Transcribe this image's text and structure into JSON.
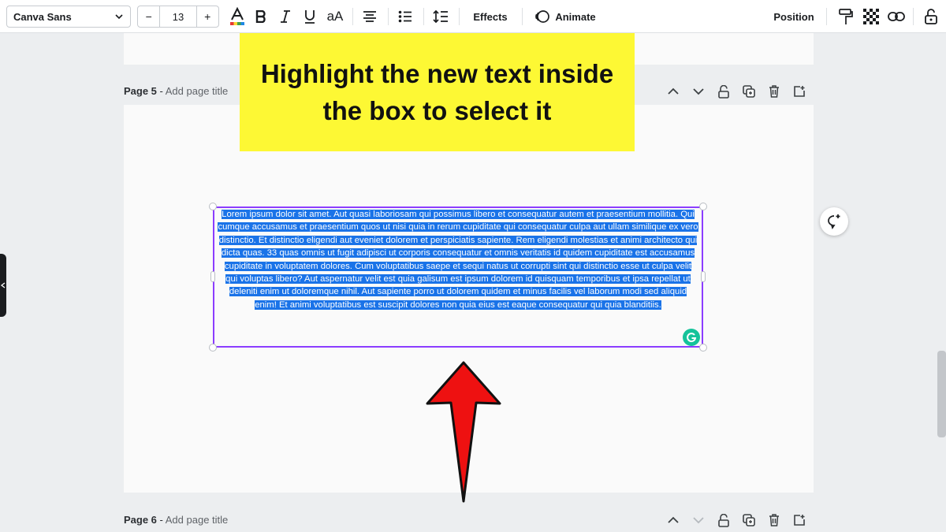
{
  "toolbar": {
    "font_family": "Canva Sans",
    "font_size": "13",
    "decrease_label": "−",
    "increase_label": "+",
    "case_label": "aA",
    "effects_label": "Effects",
    "animate_label": "Animate",
    "position_label": "Position"
  },
  "callout": {
    "line1": "Highlight the new text inside",
    "line2": "the box to select it"
  },
  "page5": {
    "label": "Page 5",
    "sep": " - ",
    "title_placeholder": "Add page title"
  },
  "page6": {
    "label": "Page 6",
    "sep": " - ",
    "title_placeholder": "Add page title"
  },
  "textbox": {
    "content": "Lorem ipsum dolor sit amet. Aut quasi laboriosam qui possimus libero et consequatur autem et praesentium mollitia. Qui cumque accusamus et praesentium quos ut nisi quia in rerum cupiditate qui consequatur culpa aut ullam similique ex vero distinctio. Et distinctio eligendi aut eveniet dolorem et perspiciatis sapiente. Rem eligendi molestias et animi architecto qui dicta quas. 33 quas omnis ut fugit adipisci ut corporis consequatur et omnis veritatis id quidem cupiditate est accusamus cupiditate in voluptatem dolores. Cum voluptatibus saepe et sequi natus ut corrupti sint qui distinctio esse ut culpa velit qui voluptas libero? Aut aspernatur velit est quia galisum est ipsum dolorem id quisquam temporibus et ipsa repellat ut deleniti enim ut doloremque nihil. Aut sapiente porro ut dolorem quidem et minus facilis vel laborum modi sed aliquid enim! Et animi voluptatibus est suscipit dolores non quia eius est eaque consequatur qui quia blanditiis."
  },
  "colors": {
    "selection": "#1a73e8",
    "frame": "#8b3dff",
    "callout_bg": "#fdf834",
    "arrow": "#ee1111"
  }
}
